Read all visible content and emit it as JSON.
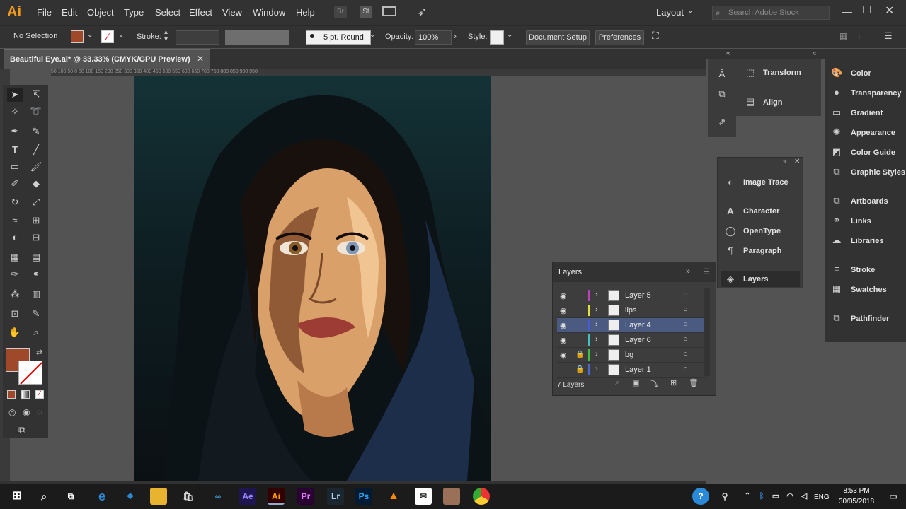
{
  "app": {
    "logo": "Ai"
  },
  "menu": [
    "File",
    "Edit",
    "Object",
    "Type",
    "Select",
    "Effect",
    "View",
    "Window",
    "Help"
  ],
  "topbar": {
    "layout_label": "Layout",
    "search_placeholder": "Search Adobe Stock"
  },
  "control": {
    "selection": "No Selection",
    "stroke_label": "Stroke:",
    "brush": "5 pt. Round",
    "opacity_label": "Opacity:",
    "opacity_value": "100%",
    "style_label": "Style:",
    "document_setup": "Document Setup",
    "preferences": "Preferences",
    "fill_color": "#a0492a"
  },
  "document": {
    "tab_title": "Beautiful Eye.ai* @ 33.33% (CMYK/GPU Preview)"
  },
  "ruler_text": "50 100 50 0 50 100 150 200 250 300 350 400 450 500 550 600 650 700 750 800 850 900 950",
  "panels": {
    "col2": [
      {
        "label": "Transform",
        "icon": "transform-icon"
      },
      {
        "label": "Align",
        "icon": "align-icon"
      }
    ],
    "col3": [
      {
        "label": "Color"
      },
      {
        "label": "Transparency"
      },
      {
        "label": "Gradient"
      },
      {
        "label": "Appearance"
      },
      {
        "label": "Color Guide"
      },
      {
        "label": "Graphic Styles"
      },
      {
        "label": "Artboards"
      },
      {
        "label": "Links"
      },
      {
        "label": "Libraries"
      },
      {
        "label": "Stroke"
      },
      {
        "label": "Swatches"
      },
      {
        "label": "Pathfinder"
      }
    ],
    "float": [
      {
        "label": "Image Trace"
      },
      {
        "label": "Character"
      },
      {
        "label": "OpenType"
      },
      {
        "label": "Paragraph"
      },
      {
        "label": "Layers"
      }
    ]
  },
  "layers_panel": {
    "title": "Layers",
    "footer": "7 Layers",
    "rows": [
      {
        "name": "Layer 5",
        "color": "#c041c0",
        "visible": true,
        "locked": false,
        "selected": false
      },
      {
        "name": "lips",
        "color": "#e0e040",
        "visible": true,
        "locked": false,
        "selected": false
      },
      {
        "name": "Layer 4",
        "color": "#4a5ad0",
        "visible": true,
        "locked": false,
        "selected": true
      },
      {
        "name": "Layer 6",
        "color": "#40c0c0",
        "visible": true,
        "locked": false,
        "selected": false
      },
      {
        "name": "bg",
        "color": "#40c040",
        "visible": true,
        "locked": true,
        "selected": false
      },
      {
        "name": "Layer 1",
        "color": "#4a6ad0",
        "visible": false,
        "locked": true,
        "selected": false
      }
    ]
  },
  "taskbar": {
    "time": "8:53 PM",
    "date": "30/05/2018",
    "lang": "ENG"
  }
}
